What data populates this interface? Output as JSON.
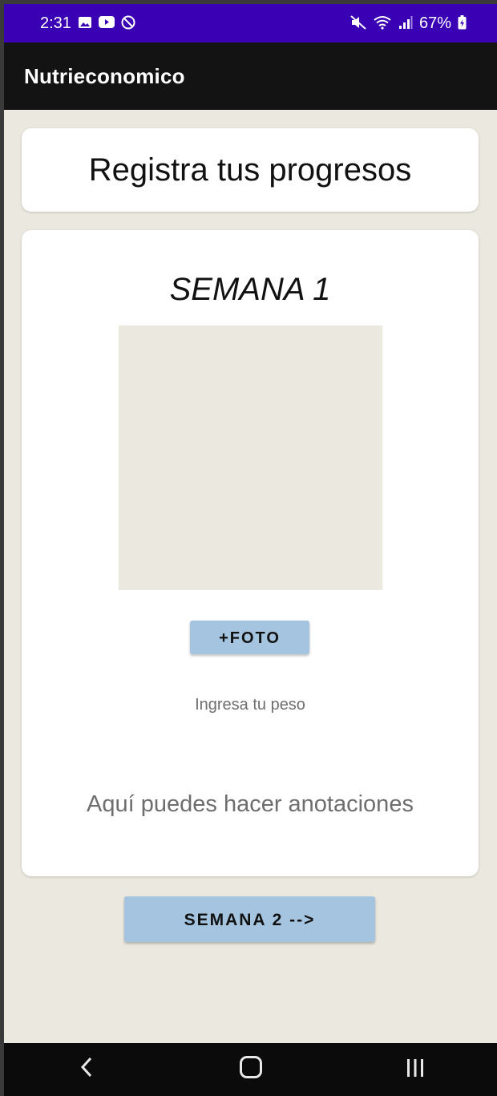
{
  "status_bar": {
    "time": "2:31",
    "left_icons": [
      "gallery-icon",
      "youtube-icon",
      "do-not-disturb-icon"
    ],
    "right_icons": [
      "mute-icon",
      "wifi-icon",
      "signal-icon"
    ],
    "battery": "67%"
  },
  "app_bar": {
    "title": "Nutrieconomico"
  },
  "header": {
    "title": "Registra tus progresos"
  },
  "week": {
    "title": "SEMANA 1",
    "photo_button": "+FOTO",
    "weight_placeholder": "Ingresa tu peso",
    "notes_placeholder": "Aquí puedes hacer anotaciones"
  },
  "next_week_button": "SEMANA 2 -->",
  "colors": {
    "status_bar": "#3a00b4",
    "app_bar": "#131313",
    "background": "#ebe9df",
    "button": "#a5c4e0"
  }
}
